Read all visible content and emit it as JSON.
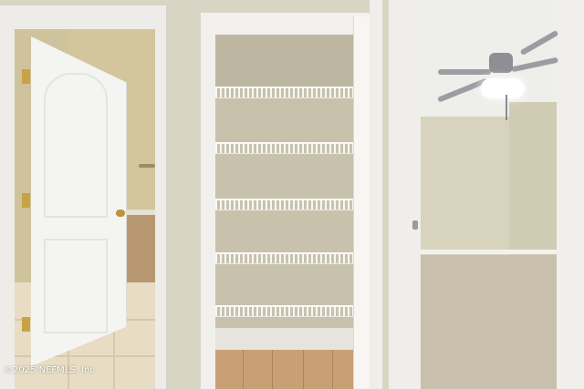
{
  "photo": {
    "watermark": "©2025 NEFMLS, Inc"
  },
  "colors": {
    "wall": "#d9d5c5",
    "trim": "#eeece8",
    "closet_interior": "#c8c2ad",
    "wood_floor": "#c9a076",
    "carpet": "#c8bfac",
    "hinge_brass": "#c9a246"
  },
  "closet": {
    "shelf_count": 5
  },
  "icons": [
    "ceiling-fan-icon",
    "door-hinge-icon",
    "door-knob-icon",
    "towel-bar-icon"
  ]
}
